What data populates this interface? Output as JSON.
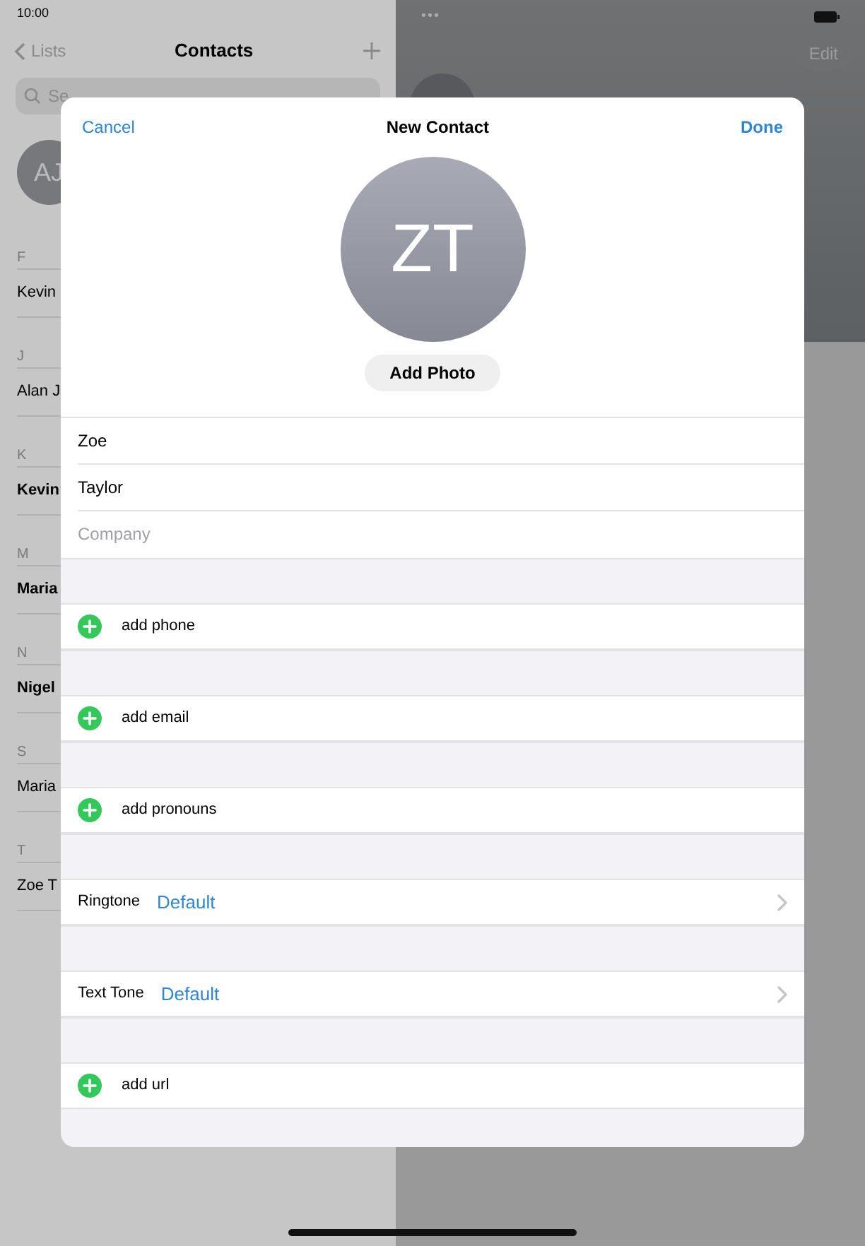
{
  "status_bar": {
    "time": "10:00",
    "dots": "•••"
  },
  "contacts_list": {
    "back": "Lists",
    "title": "Contacts",
    "search": {
      "placeholder": "Se"
    },
    "card_initials": "AJ",
    "sections": [
      {
        "letter": "F",
        "names": [
          "Kevin"
        ],
        "bold": false
      },
      {
        "letter": "J",
        "names": [
          "Alan J"
        ],
        "bold": false
      },
      {
        "letter": "K",
        "names": [
          "Kevin"
        ],
        "bold": true
      },
      {
        "letter": "M",
        "names": [
          "Maria"
        ],
        "bold": true
      },
      {
        "letter": "N",
        "names": [
          "Nigel"
        ],
        "bold": true
      },
      {
        "letter": "S",
        "names": [
          "Maria"
        ],
        "bold": false
      },
      {
        "letter": "T",
        "names": [
          "Zoe T"
        ],
        "bold": false
      }
    ]
  },
  "detail": {
    "edit": "Edit"
  },
  "modal": {
    "cancel": "Cancel",
    "title": "New Contact",
    "done": "Done",
    "initials": "ZT",
    "add_photo": "Add Photo",
    "fields": [
      {
        "value": "Zoe"
      },
      {
        "value": "Taylor"
      },
      {
        "placeholder": "Company"
      }
    ],
    "rows": [
      {
        "kind": "add",
        "label": "add phone"
      },
      {
        "kind": "add",
        "label": "add email"
      },
      {
        "kind": "add",
        "label": "add pronouns"
      },
      {
        "kind": "setting",
        "label": "Ringtone",
        "value": "Default"
      },
      {
        "kind": "setting",
        "label": "Text Tone",
        "value": "Default"
      },
      {
        "kind": "add",
        "label": "add url"
      }
    ]
  }
}
